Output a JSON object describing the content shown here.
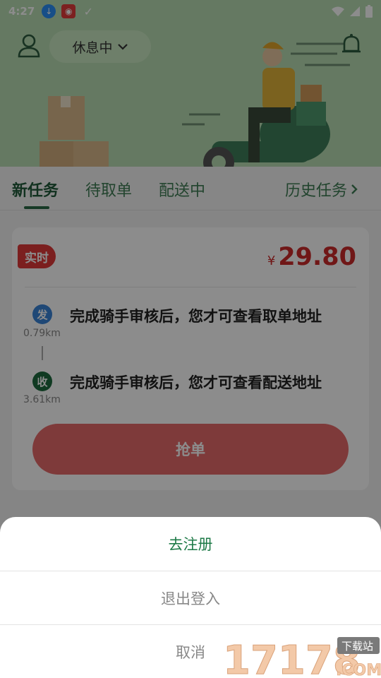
{
  "status_bar": {
    "time": "4:27"
  },
  "header": {
    "status_label": "休息中"
  },
  "tabs": [
    {
      "label": "新任务",
      "active": true
    },
    {
      "label": "待取单",
      "active": false
    },
    {
      "label": "配送中",
      "active": false
    }
  ],
  "history_tab": {
    "label": "历史任务"
  },
  "order": {
    "badge": "实时",
    "currency": "¥",
    "price": "29.80",
    "pickup": {
      "badge": "发",
      "distance": "0.79km",
      "text": "完成骑手审核后，您才可查看取单地址"
    },
    "delivery": {
      "badge": "收",
      "distance": "3.61km",
      "text": "完成骑手审核后，您才可查看配送地址"
    },
    "grab_label": "抢单"
  },
  "sheet": {
    "register": "去注册",
    "logout": "退出登入",
    "cancel": "取消"
  },
  "watermark": {
    "brand": "17178",
    "tag": "下载站",
    "suffix": ".COM"
  },
  "colors": {
    "brand_green": "#1d7a47",
    "price_red": "#cc2a2a",
    "pickup_blue": "#3a84d8",
    "delivery_green": "#1e6b3e"
  }
}
